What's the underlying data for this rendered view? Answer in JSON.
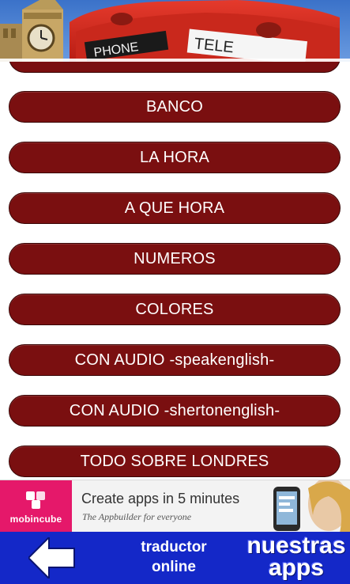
{
  "header": {
    "image": "big-ben-telephone-booth-banner"
  },
  "menu": {
    "items": [
      {
        "label": ""
      },
      {
        "label": "BANCO"
      },
      {
        "label": "LA HORA"
      },
      {
        "label": "A QUE HORA"
      },
      {
        "label": "NUMEROS"
      },
      {
        "label": "COLORES"
      },
      {
        "label": "CON AUDIO -speakenglish-"
      },
      {
        "label": "CON AUDIO -shertonenglish-"
      },
      {
        "label": "TODO SOBRE LONDRES"
      }
    ]
  },
  "ad": {
    "brand": "mobincube",
    "title": "Create apps in 5 minutes",
    "subtitle": "The Appbuilder for everyone"
  },
  "bottom_nav": {
    "back_icon": "left-arrow-icon",
    "translator_line1": "traductor",
    "translator_line2": "online",
    "apps_line1": "nuestras",
    "apps_line2": "apps"
  },
  "colors": {
    "button": "#7a0f10",
    "bottom_bar": "#1428c8",
    "ad_brand": "#e5186a"
  }
}
